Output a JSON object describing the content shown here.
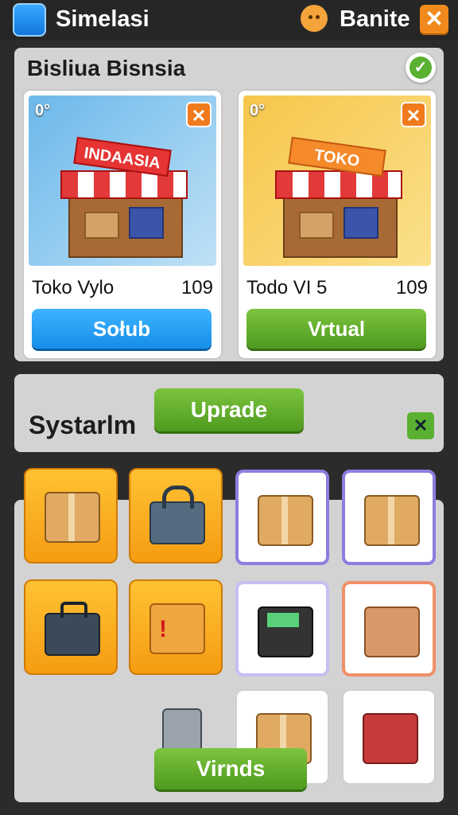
{
  "header": {
    "app_title": "Simelasi",
    "user_name": "Banite",
    "close_label": "✕"
  },
  "business": {
    "title": "Bisliua Bisnsia",
    "shops": [
      {
        "sign": "INDAASIA",
        "level": "0°",
        "name": "Toko Vylo",
        "count": "109",
        "button": "Sołub"
      },
      {
        "sign": "TOKO",
        "level": "0°",
        "name": "Todo VI 5",
        "count": "109",
        "button": "Vrtual"
      }
    ]
  },
  "system": {
    "title": "Systarlm",
    "upgrade_label": "Uprade"
  },
  "inventory": {
    "items": [
      "box-plant",
      "padlock",
      "box-straw",
      "box-tape",
      "briefcase",
      "red-tag-box",
      "cash-register",
      "open-box",
      "gadget",
      "lock-box",
      "cart-boxes"
    ]
  },
  "bottom": {
    "button_label": "Virnds"
  },
  "colors": {
    "accent_green": "#5ab031",
    "accent_blue": "#168ee8",
    "accent_orange": "#f08a1c"
  }
}
